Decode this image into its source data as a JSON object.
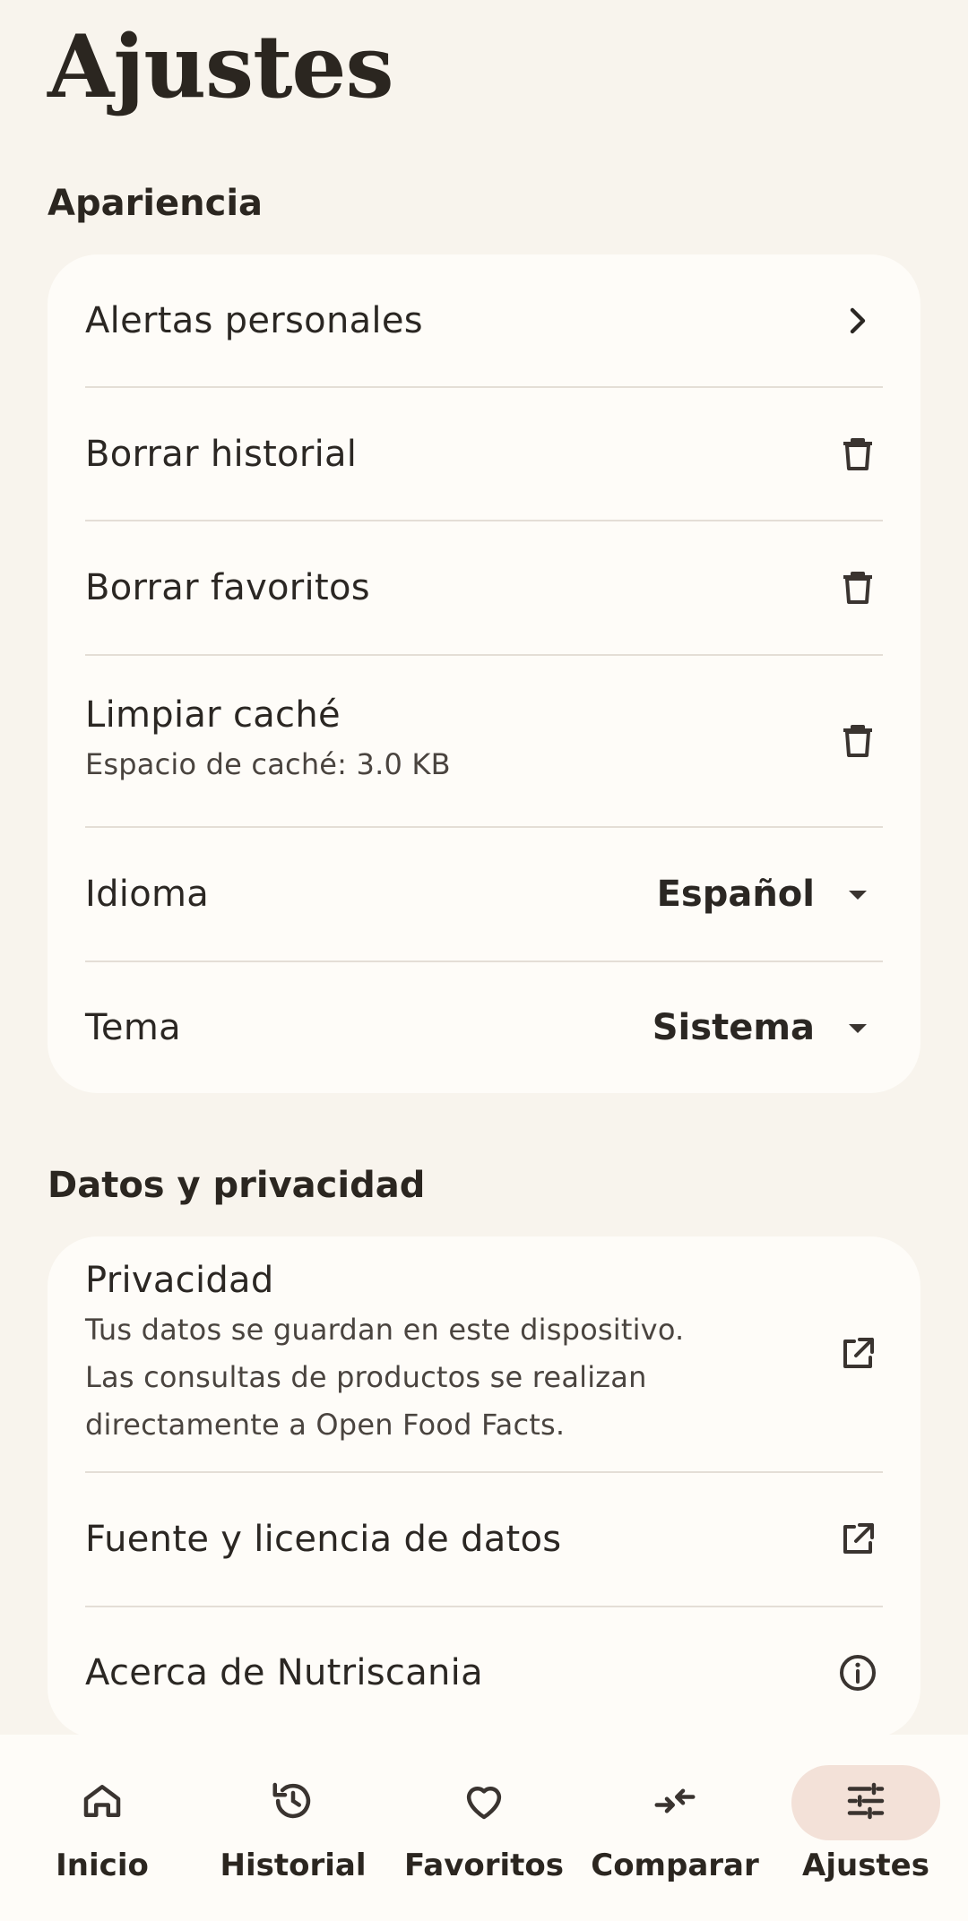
{
  "page": {
    "title": "Ajustes"
  },
  "sections": {
    "appearance": {
      "title": "Apariencia",
      "rows": {
        "alerts": {
          "title": "Alertas personales",
          "icon": "chevron-right-icon"
        },
        "clear_history": {
          "title": "Borrar historial",
          "icon": "trash-icon"
        },
        "clear_favorites": {
          "title": "Borrar favoritos",
          "icon": "trash-icon"
        },
        "clear_cache": {
          "title": "Limpiar caché",
          "subtitle": "Espacio de caché: 3.0 KB",
          "icon": "trash-icon"
        },
        "language": {
          "title": "Idioma",
          "value": "Español",
          "icon": "dropdown-arrow-icon"
        },
        "theme": {
          "title": "Tema",
          "value": "Sistema",
          "icon": "dropdown-arrow-icon"
        }
      }
    },
    "data_privacy": {
      "title": "Datos y privacidad",
      "rows": {
        "privacy": {
          "title": "Privacidad",
          "subtitle_line1": "Tus datos se guardan en este dispositivo.",
          "subtitle_line2": "Las consultas de productos se realizan",
          "subtitle_line3": "directamente a Open Food Facts.",
          "icon": "open-external-icon"
        },
        "source_license": {
          "title": "Fuente y licencia de datos",
          "icon": "open-external-icon"
        },
        "about": {
          "title": "Acerca de Nutriscania",
          "icon": "info-icon"
        }
      }
    }
  },
  "bottom_nav": {
    "items": [
      {
        "label": "Inicio",
        "icon": "home-icon"
      },
      {
        "label": "Historial",
        "icon": "history-icon"
      },
      {
        "label": "Favoritos",
        "icon": "heart-icon"
      },
      {
        "label": "Comparar",
        "icon": "compare-icon"
      },
      {
        "label": "Ajustes",
        "icon": "tune-icon",
        "active": true
      }
    ]
  },
  "colors": {
    "background": "#f8f4ed",
    "card": "#fefcf8",
    "text": "#2b2723",
    "active_indicator": "#f3e1d8"
  }
}
